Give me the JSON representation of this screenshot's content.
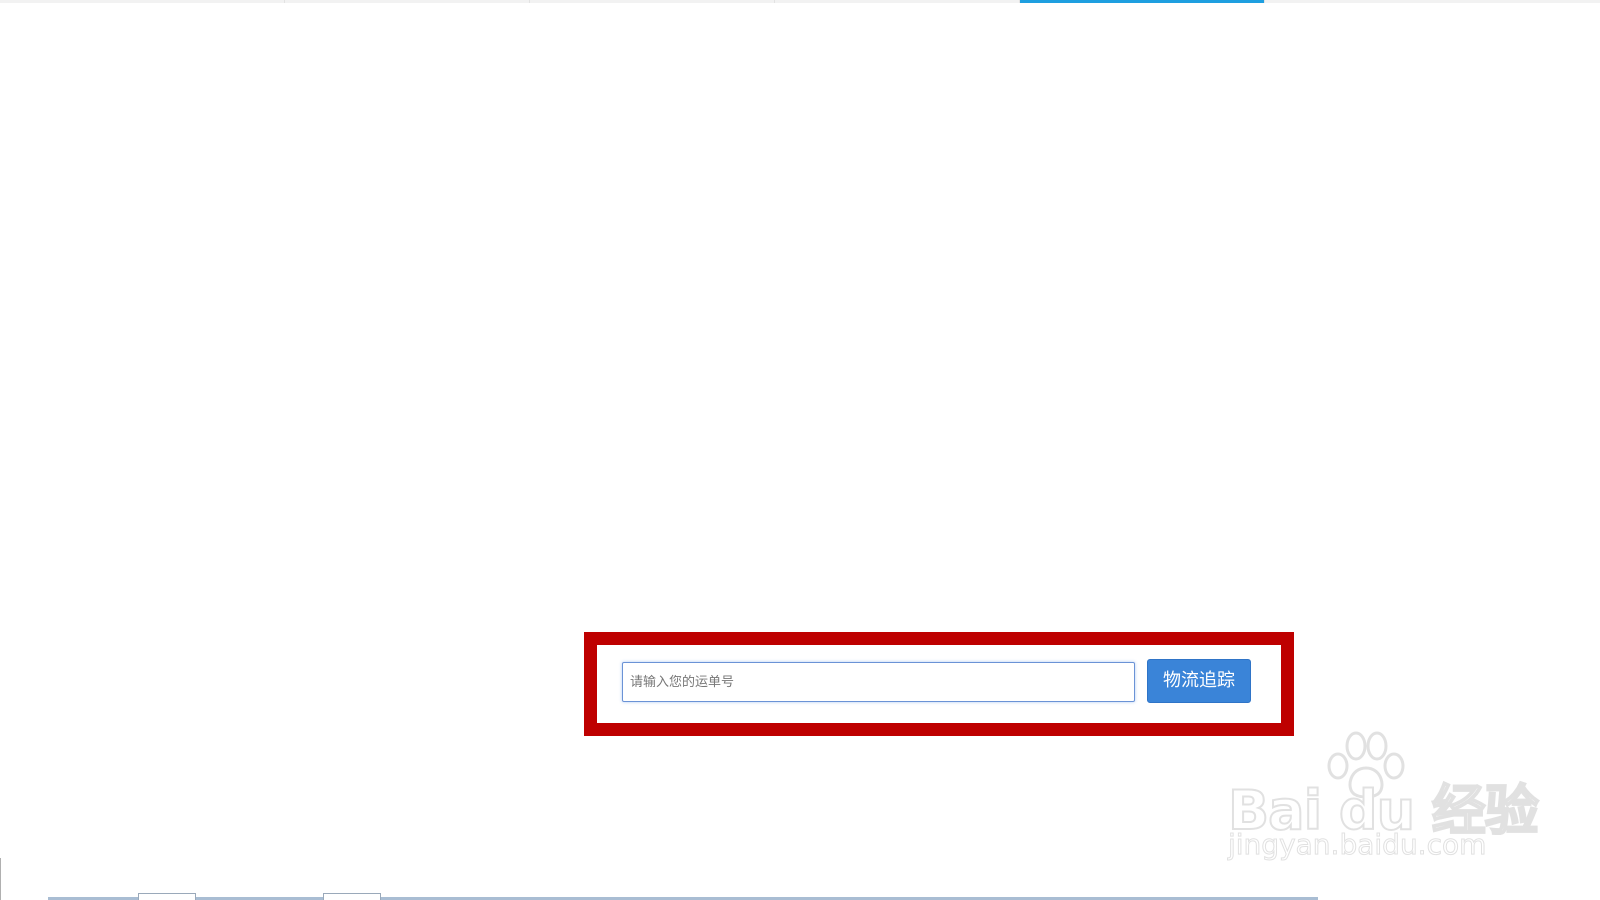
{
  "top_tabs": {
    "count": 5,
    "active_index": 4
  },
  "search": {
    "placeholder": "请输入您的运单号",
    "value": ""
  },
  "track_button": {
    "label": "物流追踪"
  },
  "watermark": {
    "brand": "Bai du 经验",
    "url": "jingyan.baidu.com"
  },
  "colors": {
    "highlight": "#be0000",
    "button": "#3a84d8",
    "active_tab": "#1e9fe0"
  }
}
